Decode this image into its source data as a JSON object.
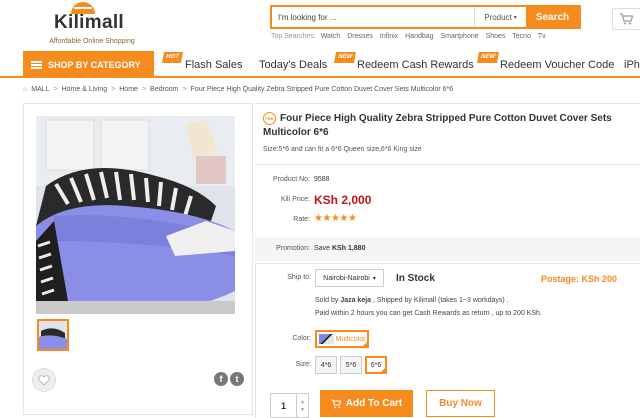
{
  "header": {
    "logo_text": "Kilimall",
    "logo_tagline": "Affordable Online Shopping",
    "search_placeholder": "I'm looking for ...",
    "search_category": "Product",
    "search_button": "Search",
    "top_searches_label": "Top Searches:",
    "top_searches": [
      "Watch",
      "Dresses",
      "Infinix",
      "Handbag",
      "Smartphone",
      "Shoes",
      "Tecno",
      "Tv"
    ]
  },
  "nav": {
    "category_button": "SHOP BY CATEGORY",
    "items": [
      {
        "label": "Flash Sales",
        "badge": "HOT"
      },
      {
        "label": "Today's Deals",
        "badge": ""
      },
      {
        "label": "Redeem Cash Rewards",
        "badge": "NEW"
      },
      {
        "label": "Redeem Voucher Code",
        "badge": "NEW"
      },
      {
        "label": "iPh",
        "badge": ""
      }
    ]
  },
  "breadcrumb": [
    "MALL",
    "Home & Living",
    "Home",
    "Bedroom",
    "Four Piece High Quality Zebra Stripped Pure Cotton Duvet Cover Sets Multicolor 6*6"
  ],
  "product": {
    "fbk_badge": "FBK",
    "title": "Four Piece High Quality Zebra Stripped Pure Cotton Duvet Cover Sets Multicolor 6*6",
    "subtitle": "Size:5*6 and can fit a 6*6 Queen size,6*6 King size",
    "product_no_label": "Product No:",
    "product_no": "9588",
    "price_label": "Kili Price:",
    "price": "KSh 2,000",
    "rate_label": "Rate:",
    "rating": 5,
    "promotion_label": "Promotion:",
    "promotion_prefix": "Save",
    "promotion_value": "KSh 1,880",
    "ship_label": "Ship to:",
    "ship_to": "Nairobi-Nairobi",
    "stock": "In Stock",
    "postage": "Postage: KSh 200",
    "sold_by_prefix": "Sold by",
    "seller": "Jaza keja",
    "sold_by_suffix": ", Shipped by Kilimall (takes 1~3 workdays) .",
    "paid_note": "Paid within 2 hours you can get Cash Rewards as return , up to 200 KSh.",
    "color_label": "Color:",
    "color": "Multicolor",
    "size_label": "Size:",
    "sizes": [
      "4*6",
      "5*6",
      "6*6"
    ],
    "selected_size": "6*6",
    "quantity": "1",
    "add_to_cart": "Add To Cart",
    "buy_now": "Buy Now"
  },
  "colors": {
    "accent": "#f68b1e",
    "price": "#c0131a",
    "star": "#f68b1e"
  }
}
